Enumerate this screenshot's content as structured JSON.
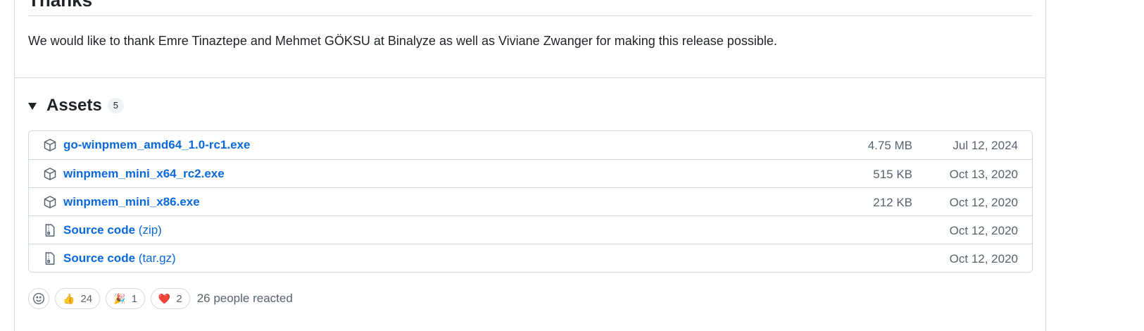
{
  "thanks": {
    "heading": "Thanks",
    "text": "We would like to thank Emre Tinaztepe and Mehmet GÖKSU at Binalyze as well as Viviane Zwanger for making this release possible."
  },
  "assets": {
    "title": "Assets",
    "count": "5",
    "items": [
      {
        "name": "go-winpmem_amd64_1.0-rc1.exe",
        "suffix": "",
        "size": "4.75 MB",
        "date": "Jul 12, 2024",
        "icon": "package-icon"
      },
      {
        "name": "winpmem_mini_x64_rc2.exe",
        "suffix": "",
        "size": "515 KB",
        "date": "Oct 13, 2020",
        "icon": "package-icon"
      },
      {
        "name": "winpmem_mini_x86.exe",
        "suffix": "",
        "size": "212 KB",
        "date": "Oct 12, 2020",
        "icon": "package-icon"
      },
      {
        "name": "Source code",
        "suffix": "(zip)",
        "size": "",
        "date": "Oct 12, 2020",
        "icon": "file-zip-icon"
      },
      {
        "name": "Source code",
        "suffix": "(tar.gz)",
        "size": "",
        "date": "Oct 12, 2020",
        "icon": "file-zip-icon"
      }
    ]
  },
  "reactions": {
    "items": [
      {
        "emoji": "👍",
        "count": "24",
        "icon": "thumbs-up-icon"
      },
      {
        "emoji": "🎉",
        "count": "1",
        "icon": "party-popper-icon"
      },
      {
        "emoji": "❤️",
        "count": "2",
        "icon": "heart-icon"
      }
    ],
    "summary": "26 people reacted"
  }
}
